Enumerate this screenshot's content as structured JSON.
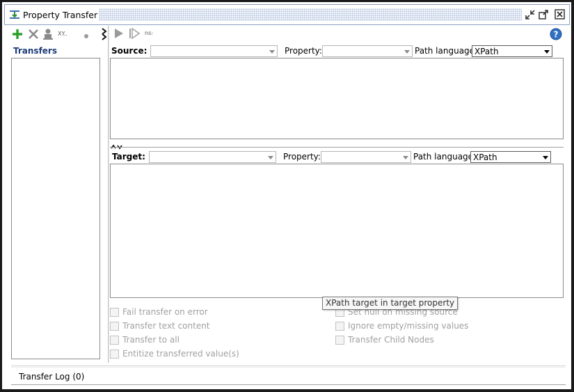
{
  "window": {
    "title": "Property Transfer"
  },
  "left_toolbar": {
    "xpath_hint": "XY..",
    "dot_icon": "record-icon"
  },
  "transfers": {
    "label": "Transfers",
    "items": []
  },
  "right_toolbar": {
    "ns_label": "ns:"
  },
  "source": {
    "label": "Source:",
    "value": "",
    "property_label": "Property:",
    "property_value": "",
    "path_language_label": "Path language:",
    "path_language_value": "XPath",
    "expression": ""
  },
  "target": {
    "label": "Target:",
    "value": "",
    "property_label": "Property:",
    "property_value": "",
    "path_language_label": "Path language:",
    "path_language_value": "XPath",
    "expression": ""
  },
  "options": {
    "fail_on_error": "Fail transfer on error",
    "transfer_text": "Transfer text content",
    "transfer_all": "Transfer to all",
    "entitize": "Entitize transferred value(s)",
    "set_null": "Set null on missing source",
    "ignore_empty": "Ignore empty/missing values",
    "child_nodes": "Transfer Child Nodes"
  },
  "tooltip": "XPath target in target property",
  "bottom": {
    "transfer_log": "Transfer Log (0)"
  },
  "colors": {
    "accent_blue": "#1f3d7a",
    "add_green": "#2aa02a",
    "disabled_text": "#a0a0a0"
  }
}
